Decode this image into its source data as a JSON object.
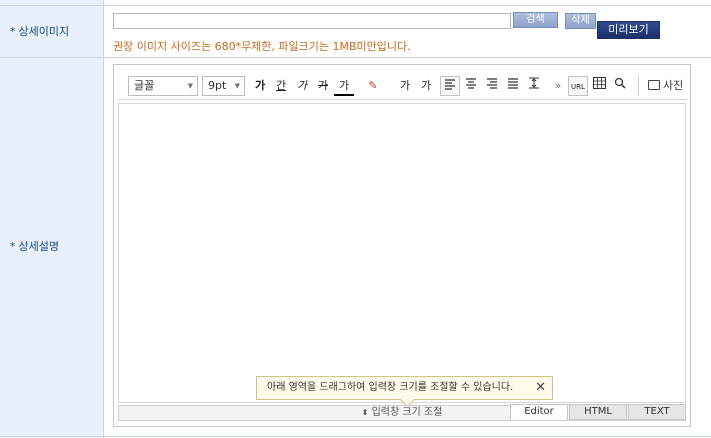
{
  "rows": {
    "detail_image": {
      "label": "상세이미지"
    },
    "detail_desc": {
      "label": "상세설명"
    }
  },
  "image_upload": {
    "search_button": "검색",
    "delete_button": "삭제",
    "preview_button": "미리보기",
    "hint": "권장 이미지 사이즈는 680*무제한, 파일크기는 1MB미만입니다."
  },
  "editor": {
    "font_select": "글꼴",
    "size_select": "9pt",
    "toolbar_glyphs": {
      "bold": "가",
      "underline": "간",
      "italic": "가",
      "strike": "가",
      "fontcolor": "가",
      "highlight": "✎",
      "superscript": "가",
      "subscript": "가",
      "more": "»",
      "url": "URL",
      "photo": "사진"
    },
    "tip_text": "아래 영역을 드래그하여 입력창 크기를 조절할 수 있습니다.",
    "resize_label": "입력창 크기 조절",
    "tabs": [
      "Editor",
      "HTML",
      "TEXT"
    ]
  }
}
